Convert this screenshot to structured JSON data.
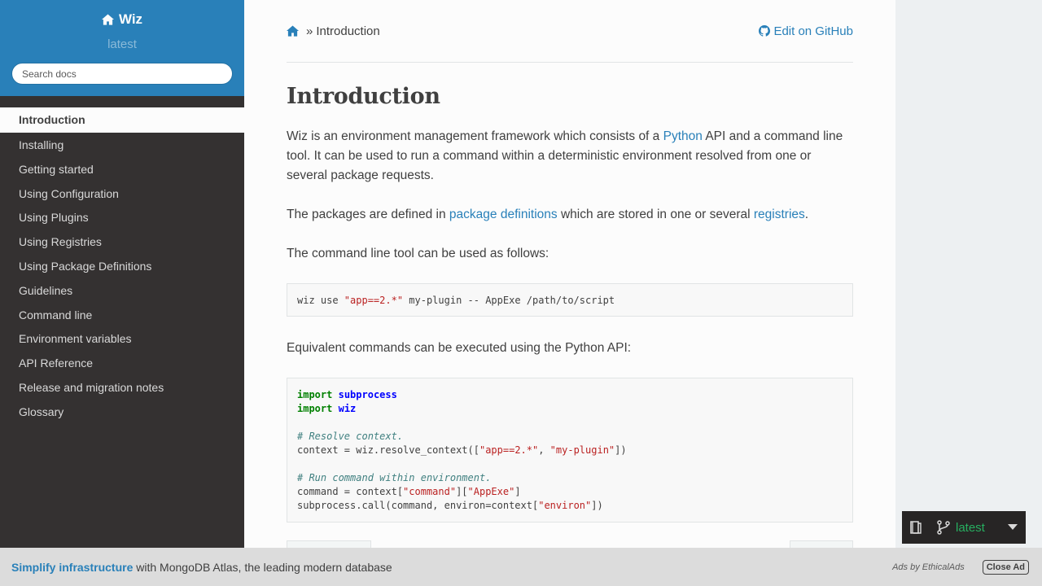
{
  "sidebar": {
    "project_title": "Wiz",
    "version": "latest",
    "search_placeholder": "Search docs",
    "items": [
      {
        "label": "Introduction",
        "current": true
      },
      {
        "label": "Installing"
      },
      {
        "label": "Getting started"
      },
      {
        "label": "Using Configuration"
      },
      {
        "label": "Using Plugins"
      },
      {
        "label": "Using Registries"
      },
      {
        "label": "Using Package Definitions"
      },
      {
        "label": "Guidelines"
      },
      {
        "label": "Command line"
      },
      {
        "label": "Environment variables"
      },
      {
        "label": "API Reference"
      },
      {
        "label": "Release and migration notes"
      },
      {
        "label": "Glossary"
      }
    ]
  },
  "breadcrumbs": {
    "separator": "»",
    "current": "Introduction",
    "edit_label": "Edit on GitHub"
  },
  "page": {
    "title": "Introduction",
    "p1_a": "Wiz is an environment management framework which consists of a ",
    "p1_link": "Python",
    "p1_b": " API and a command line tool. It can be used to run a command within a deterministic environment resolved from one or several package requests.",
    "p2_a": "The packages are defined in ",
    "p2_link1": "package definitions",
    "p2_b": " which are stored in one or several ",
    "p2_link2": "registries",
    "p2_c": ".",
    "p3": "The command line tool can be used as follows:",
    "cmd": {
      "a": "wiz use ",
      "s": "\"app==2.*\"",
      "b": " my-plugin -- AppExe /path/to/script"
    },
    "p4": "Equivalent commands can be executed using the Python API:",
    "code": {
      "import": "import",
      "subprocess": "subprocess",
      "wiz": "wiz",
      "comment1": "# Resolve context.",
      "l4a": "context = wiz.resolve_context([",
      "l4s1": "\"app==2.*\"",
      "l4b": ", ",
      "l4s2": "\"my-plugin\"",
      "l4c": "])",
      "comment2": "# Run command within environment.",
      "l6a": "command = context[",
      "l6s1": "\"command\"",
      "l6b": "][",
      "l6s2": "\"AppExe\"",
      "l6c": "]",
      "l7a": "subprocess.call(command, environ=context[",
      "l7s": "\"environ\"",
      "l7b": "])"
    }
  },
  "versions_widget": {
    "label": "latest"
  },
  "ad": {
    "strong": "Simplify infrastructure",
    "text": " with MongoDB Atlas, the leading modern database",
    "ads_by": "Ads by EthicalAds",
    "close": "Close Ad"
  },
  "colors": {
    "accent": "#2980b9",
    "sidebar_bg": "#343131",
    "version_green": "#27ae60"
  }
}
